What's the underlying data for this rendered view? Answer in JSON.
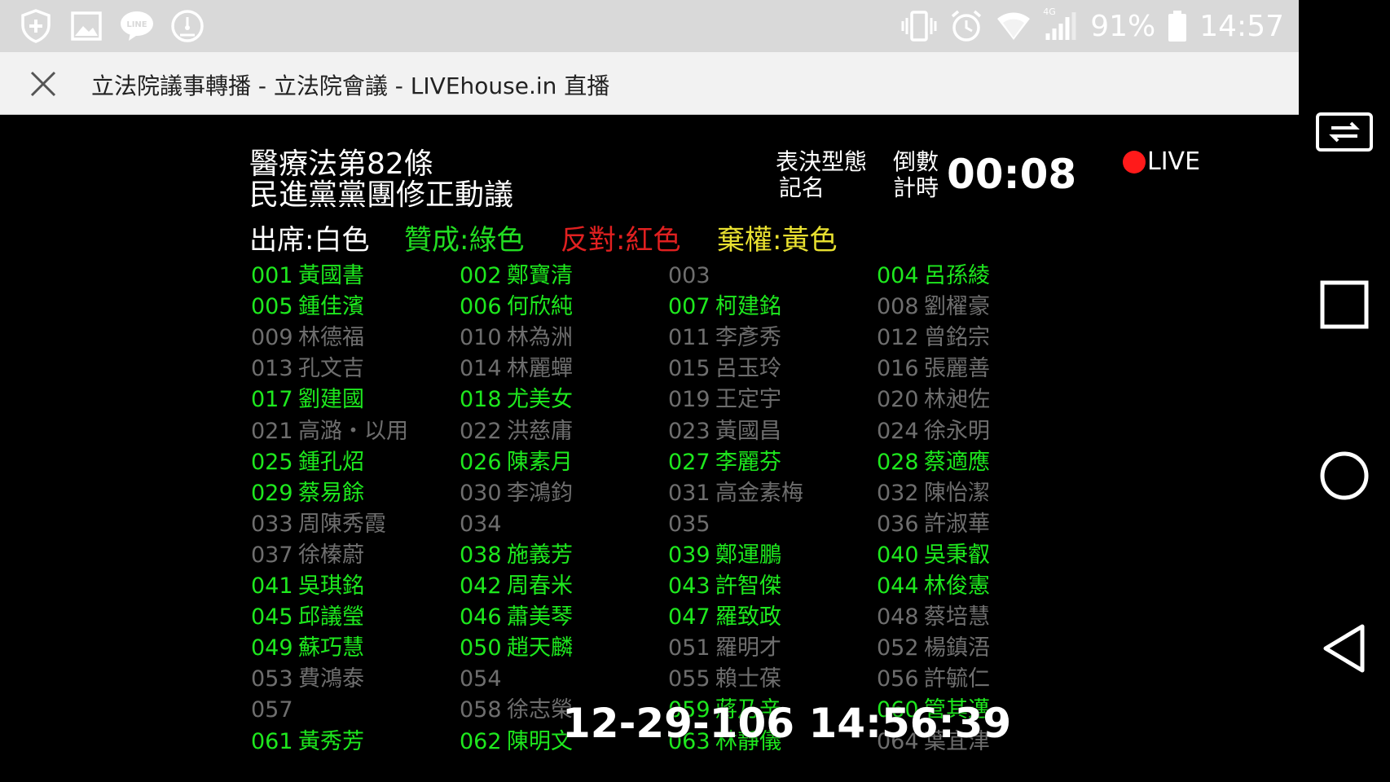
{
  "status_bar": {
    "left_icons": [
      "shield-plus-icon",
      "gallery-icon",
      "line-chat-icon",
      "gauge-icon"
    ],
    "right_icons": [
      "vibrate-icon",
      "alarm-icon",
      "wifi-icon",
      "signal-4g-icon",
      "battery-icon"
    ],
    "network_label": "4G",
    "battery": "91%",
    "time": "14:57"
  },
  "title_bar": {
    "close_icon": "close-icon",
    "title": "立法院議事轉播 - 立法院會議 - LIVEhouse.in 直播"
  },
  "video": {
    "title_line1": "醫療法第82條",
    "title_line2": "民進黨黨團修正動議",
    "vote_type_line1": "表決型態",
    "vote_type_line2": "記名",
    "countdown_label": "倒數計時",
    "countdown": "00:08",
    "live_label": "LIVE",
    "legend": [
      {
        "text": "出席:白色",
        "color": "#ffffff"
      },
      {
        "text": "贊成:綠色",
        "color": "#22dd22"
      },
      {
        "text": "反對:紅色",
        "color": "#e02020"
      },
      {
        "text": "棄權:黃色",
        "color": "#e8e030"
      }
    ],
    "colors": {
      "yes": "#1ee81e",
      "present": "#6e6e6e"
    },
    "seats": [
      {
        "num": "001",
        "name": "黃國書",
        "status": "yes"
      },
      {
        "num": "002",
        "name": "鄭寶清",
        "status": "yes"
      },
      {
        "num": "003",
        "name": "",
        "status": "present"
      },
      {
        "num": "004",
        "name": "呂孫綾",
        "status": "yes"
      },
      {
        "num": "005",
        "name": "鍾佳濱",
        "status": "yes"
      },
      {
        "num": "006",
        "name": "何欣純",
        "status": "yes"
      },
      {
        "num": "007",
        "name": "柯建銘",
        "status": "yes"
      },
      {
        "num": "008",
        "name": "劉櫂豪",
        "status": "present"
      },
      {
        "num": "009",
        "name": "林德福",
        "status": "present"
      },
      {
        "num": "010",
        "name": "林為洲",
        "status": "present"
      },
      {
        "num": "011",
        "name": "李彥秀",
        "status": "present"
      },
      {
        "num": "012",
        "name": "曾銘宗",
        "status": "present"
      },
      {
        "num": "013",
        "name": "孔文吉",
        "status": "present"
      },
      {
        "num": "014",
        "name": "林麗蟬",
        "status": "present"
      },
      {
        "num": "015",
        "name": "呂玉玲",
        "status": "present"
      },
      {
        "num": "016",
        "name": "張麗善",
        "status": "present"
      },
      {
        "num": "017",
        "name": "劉建國",
        "status": "yes"
      },
      {
        "num": "018",
        "name": "尤美女",
        "status": "yes"
      },
      {
        "num": "019",
        "name": "王定宇",
        "status": "present"
      },
      {
        "num": "020",
        "name": "林昶佐",
        "status": "present"
      },
      {
        "num": "021",
        "name": "高潞・以用",
        "status": "present"
      },
      {
        "num": "022",
        "name": "洪慈庸",
        "status": "present"
      },
      {
        "num": "023",
        "name": "黃國昌",
        "status": "present"
      },
      {
        "num": "024",
        "name": "徐永明",
        "status": "present"
      },
      {
        "num": "025",
        "name": "鍾孔炤",
        "status": "yes"
      },
      {
        "num": "026",
        "name": "陳素月",
        "status": "yes"
      },
      {
        "num": "027",
        "name": "李麗芬",
        "status": "yes"
      },
      {
        "num": "028",
        "name": "蔡適應",
        "status": "yes"
      },
      {
        "num": "029",
        "name": "蔡易餘",
        "status": "yes"
      },
      {
        "num": "030",
        "name": "李鴻鈞",
        "status": "present"
      },
      {
        "num": "031",
        "name": "高金素梅",
        "status": "present"
      },
      {
        "num": "032",
        "name": "陳怡潔",
        "status": "present"
      },
      {
        "num": "033",
        "name": "周陳秀霞",
        "status": "present"
      },
      {
        "num": "034",
        "name": "",
        "status": "present"
      },
      {
        "num": "035",
        "name": "",
        "status": "present"
      },
      {
        "num": "036",
        "name": "許淑華",
        "status": "present"
      },
      {
        "num": "037",
        "name": "徐榛蔚",
        "status": "present"
      },
      {
        "num": "038",
        "name": "施義芳",
        "status": "yes"
      },
      {
        "num": "039",
        "name": "鄭運鵬",
        "status": "yes"
      },
      {
        "num": "040",
        "name": "吳秉叡",
        "status": "yes"
      },
      {
        "num": "041",
        "name": "吳琪銘",
        "status": "yes"
      },
      {
        "num": "042",
        "name": "周春米",
        "status": "yes"
      },
      {
        "num": "043",
        "name": "許智傑",
        "status": "yes"
      },
      {
        "num": "044",
        "name": "林俊憲",
        "status": "yes"
      },
      {
        "num": "045",
        "name": "邱議瑩",
        "status": "yes"
      },
      {
        "num": "046",
        "name": "蕭美琴",
        "status": "yes"
      },
      {
        "num": "047",
        "name": "羅致政",
        "status": "yes"
      },
      {
        "num": "048",
        "name": "蔡培慧",
        "status": "present"
      },
      {
        "num": "049",
        "name": "蘇巧慧",
        "status": "yes"
      },
      {
        "num": "050",
        "name": "趙天麟",
        "status": "yes"
      },
      {
        "num": "051",
        "name": "羅明才",
        "status": "present"
      },
      {
        "num": "052",
        "name": "楊鎮浯",
        "status": "present"
      },
      {
        "num": "053",
        "name": "費鴻泰",
        "status": "present"
      },
      {
        "num": "054",
        "name": "",
        "status": "present"
      },
      {
        "num": "055",
        "name": "賴士葆",
        "status": "present"
      },
      {
        "num": "056",
        "name": "許毓仁",
        "status": "present"
      },
      {
        "num": "057",
        "name": "",
        "status": "present"
      },
      {
        "num": "058",
        "name": "徐志榮",
        "status": "present"
      },
      {
        "num": "059",
        "name": "蔣乃辛",
        "status": "yes"
      },
      {
        "num": "060",
        "name": "管其邁",
        "status": "yes"
      },
      {
        "num": "061",
        "name": "黃秀芳",
        "status": "yes"
      },
      {
        "num": "062",
        "name": "陳明文",
        "status": "yes"
      },
      {
        "num": "063",
        "name": "林靜儀",
        "status": "yes"
      },
      {
        "num": "064",
        "name": "葉宜津",
        "status": "present"
      }
    ],
    "timestamp": "12-29-106 14:56:39"
  },
  "nav_bar": {
    "buttons": [
      "screen-rotate-icon",
      "recents-icon",
      "home-icon",
      "back-icon"
    ]
  }
}
